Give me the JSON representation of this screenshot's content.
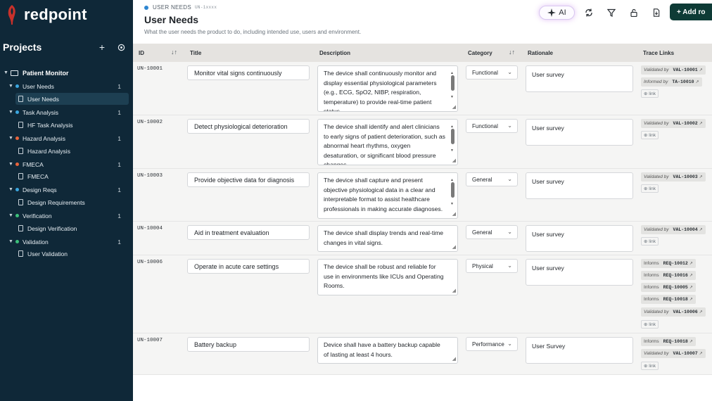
{
  "app": {
    "name": "redpoint"
  },
  "sidebar": {
    "projects_title": "Projects",
    "add_icon": "plus-icon",
    "settings_icon": "settings-icon",
    "project": {
      "name": "Patient Monitor",
      "icon": "folder-icon"
    },
    "groups": [
      {
        "label": "User Needs",
        "count": "1",
        "color": "#3ba7e0",
        "child": "User Needs"
      },
      {
        "label": "Task Analysis",
        "count": "1",
        "color": "#3ba7e0",
        "child": "HF Task Analysis"
      },
      {
        "label": "Hazard Analysis",
        "count": "1",
        "color": "#e8643c",
        "child": "Hazard Analysis"
      },
      {
        "label": "FMECA",
        "count": "1",
        "color": "#e8643c",
        "child": "FMECA"
      },
      {
        "label": "Design Reqs",
        "count": "1",
        "color": "#3ba7e0",
        "child": "Design Requirements"
      },
      {
        "label": "Verification",
        "count": "1",
        "color": "#3cc07a",
        "child": "Design Verification"
      },
      {
        "label": "Validation",
        "count": "1",
        "color": "#3cc07a",
        "child": "User Validation"
      }
    ]
  },
  "header": {
    "breadcrumb": "USER NEEDS",
    "id_format": "UN-1xxxx",
    "title": "User Needs",
    "subtitle": "What the user needs the product to do, including intended use, users and environment.",
    "ai_label": "AI",
    "add_label": "+ Add ro",
    "toolbar_icons": [
      "sparkle-icon",
      "sync-icon",
      "filter-icon",
      "lock-icon",
      "export-icon"
    ]
  },
  "table": {
    "columns": [
      "ID",
      "Title",
      "Description",
      "Category",
      "Rationale",
      "Trace Links"
    ],
    "add_link_label": "⊕ link",
    "rows": [
      {
        "id": "UN-10001",
        "title": "Monitor vital signs continuously",
        "description": "The device shall continuously monitor and display essential physiological parameters (e.g., ECG, SpO2, NIBP, respiration, temperature) to provide real-time patient status.",
        "category": "Functional",
        "rationale": "User survey",
        "links": [
          {
            "rel": "Validated by",
            "target": "VAL-10001"
          },
          {
            "rel": "Informed by",
            "target": "TA-10010"
          }
        ]
      },
      {
        "id": "UN-10002",
        "title": "Detect physiological deterioration",
        "description": "The device shall identify and alert clinicians to early signs of patient deterioration, such as abnormal heart rhythms, oxygen desaturation, or significant blood pressure changes.",
        "category": "Functional",
        "rationale": "User survey",
        "links": [
          {
            "rel": "Validated by",
            "target": "VAL-10002"
          }
        ]
      },
      {
        "id": "UN-10003",
        "title": "Provide objective data for diagnosis",
        "description": "The device shall capture and present objective physiological data in a clear and interpretable format to assist healthcare professionals in making accurate diagnoses.",
        "category": "General",
        "rationale": "User survey",
        "links": [
          {
            "rel": "Validated by",
            "target": "VAL-10003"
          }
        ]
      },
      {
        "id": "UN-10004",
        "title": "Aid in treatment evaluation",
        "description": "The device shall display trends and real-time changes in vital signs.",
        "category": "General",
        "rationale": "User survey",
        "links": [
          {
            "rel": "Validated by",
            "target": "VAL-10004"
          }
        ]
      },
      {
        "id": "UN-10006",
        "title": "Operate in acute care settings",
        "description": "The device shall be robust and reliable for use in environments like ICUs and Operating Rooms.",
        "category": "Physical",
        "rationale": "User survey",
        "links": [
          {
            "rel": "Informs",
            "target": "REQ-10012"
          },
          {
            "rel": "Informs",
            "target": "REQ-10016"
          },
          {
            "rel": "Informs",
            "target": "REQ-10005"
          },
          {
            "rel": "Informs",
            "target": "REQ-10018"
          },
          {
            "rel": "Validated by",
            "target": "VAL-10006"
          }
        ]
      },
      {
        "id": "UN-10007",
        "title": "Battery backup",
        "description": "Device shall have a battery backup capable of lasting at least 4 hours.",
        "category": "Performance",
        "rationale": "User Survey",
        "links": [
          {
            "rel": "Informs",
            "target": "REQ-10018"
          },
          {
            "rel": "Validated by",
            "target": "VAL-10007"
          }
        ]
      }
    ]
  }
}
